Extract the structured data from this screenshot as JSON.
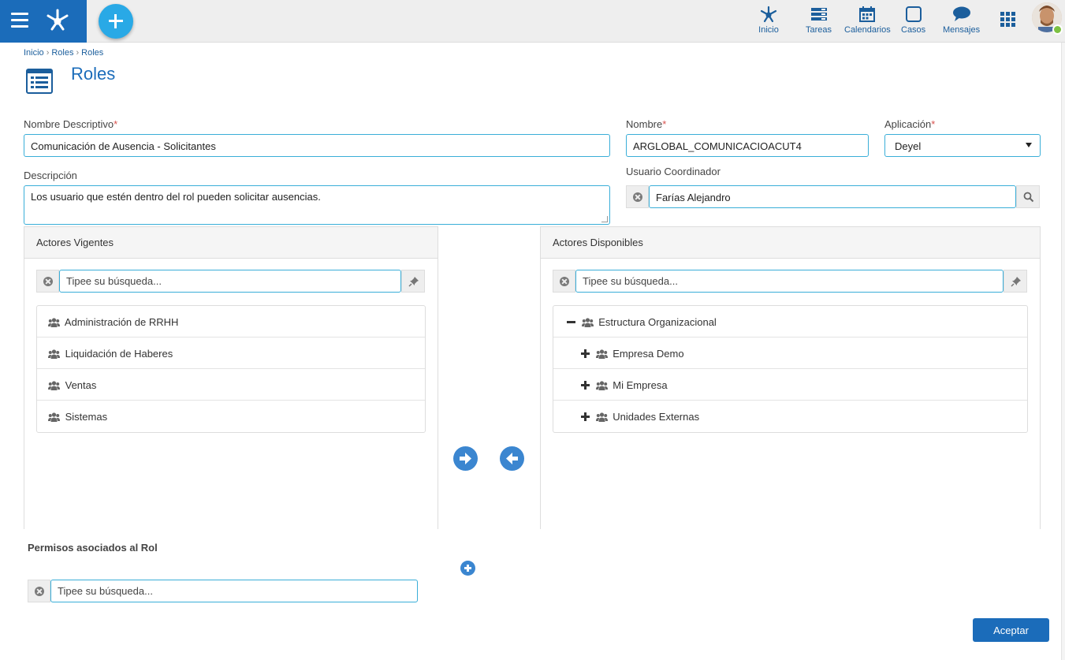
{
  "topbar": {
    "nav": [
      {
        "label": "Inicio",
        "icon": "process-icon"
      },
      {
        "label": "Tareas",
        "icon": "tasks-icon"
      },
      {
        "label": "Calendarios",
        "icon": "calendar-icon"
      },
      {
        "label": "Casos",
        "icon": "cases-icon"
      },
      {
        "label": "Mensajes",
        "icon": "messages-icon"
      }
    ],
    "brand_color": "#1b6cba",
    "fab_color": "#29a9e6",
    "status_color": "#7dc142"
  },
  "breadcrumb": [
    "Inicio",
    "Roles",
    "Roles"
  ],
  "page": {
    "title": "Roles"
  },
  "form": {
    "nombre_descriptivo_label": "Nombre Descriptivo",
    "nombre_descriptivo_value": "Comunicación de Ausencia - Solicitantes",
    "nombre_label": "Nombre",
    "nombre_value": "ARGLOBAL_COMUNICACIOACUT4",
    "aplicacion_label": "Aplicación",
    "aplicacion_value": "Deyel",
    "descripcion_label": "Descripción",
    "descripcion_value": "Los usuario que estén dentro del rol pueden solicitar ausencias.",
    "usuario_coordinador_label": "Usuario Coordinador",
    "usuario_coordinador_value": "Farías Alejandro",
    "required_mark": "*"
  },
  "actores_vigentes": {
    "title": "Actores Vigentes",
    "search_placeholder": "Tipee su búsqueda...",
    "items": [
      "Administración de RRHH",
      "Liquidación de Haberes",
      "Ventas",
      "Sistemas"
    ]
  },
  "actores_disponibles": {
    "title": "Actores Disponibles",
    "search_placeholder": "Tipee su búsqueda...",
    "root": "Estructura Organizacional",
    "children": [
      "Empresa Demo",
      "Mi Empresa",
      "Unidades Externas"
    ]
  },
  "permisos": {
    "title": "Permisos asociados al Rol",
    "search_placeholder": "Tipee su búsqueda..."
  },
  "footer": {
    "accept_label": "Aceptar"
  }
}
